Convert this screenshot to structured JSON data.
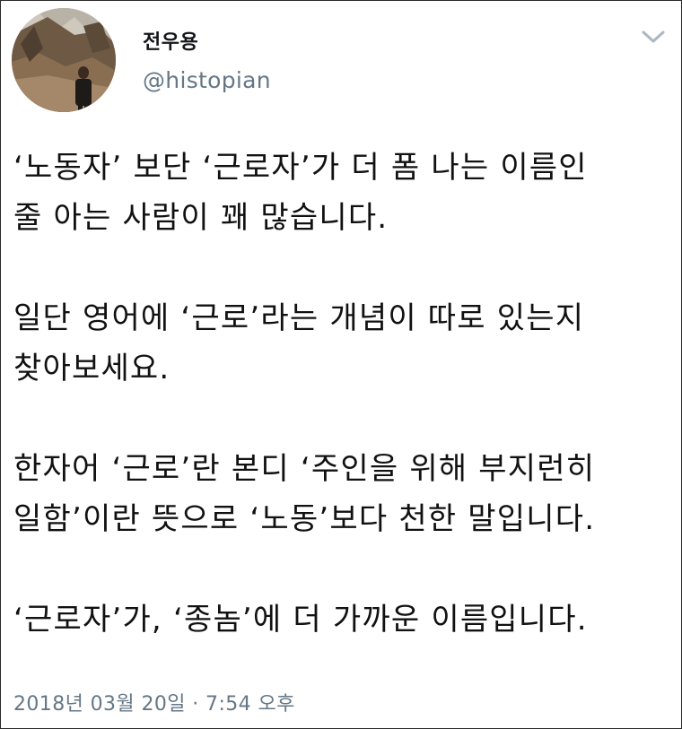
{
  "tweet": {
    "author": {
      "display_name": "전우용",
      "handle": "@histopian",
      "avatar_icon": "user-avatar-photo"
    },
    "menu_icon": "chevron-down-icon",
    "paragraphs": [
      [
        "‘노동자’ 보단 ‘근로자’가 더 폼 나는 이름인",
        "줄 아는 사람이 꽤 많습니다."
      ],
      [
        "일단 영어에 ‘근로’라는 개념이 따로 있는지",
        "찾아보세요."
      ],
      [
        "한자어 ‘근로’란 본디 ‘주인을 위해 부지런히",
        "일함’이란 뜻으로 ‘노동’보다 천한 말입니다."
      ],
      [
        "‘근로자’가, ‘종놈’에 더 가까운 이름입니다."
      ]
    ],
    "timestamp": "2018년 03월 20일 · 7:54 오후"
  },
  "colors": {
    "text": "#14171a",
    "secondary": "#657786",
    "border": "#2a2a2a"
  }
}
